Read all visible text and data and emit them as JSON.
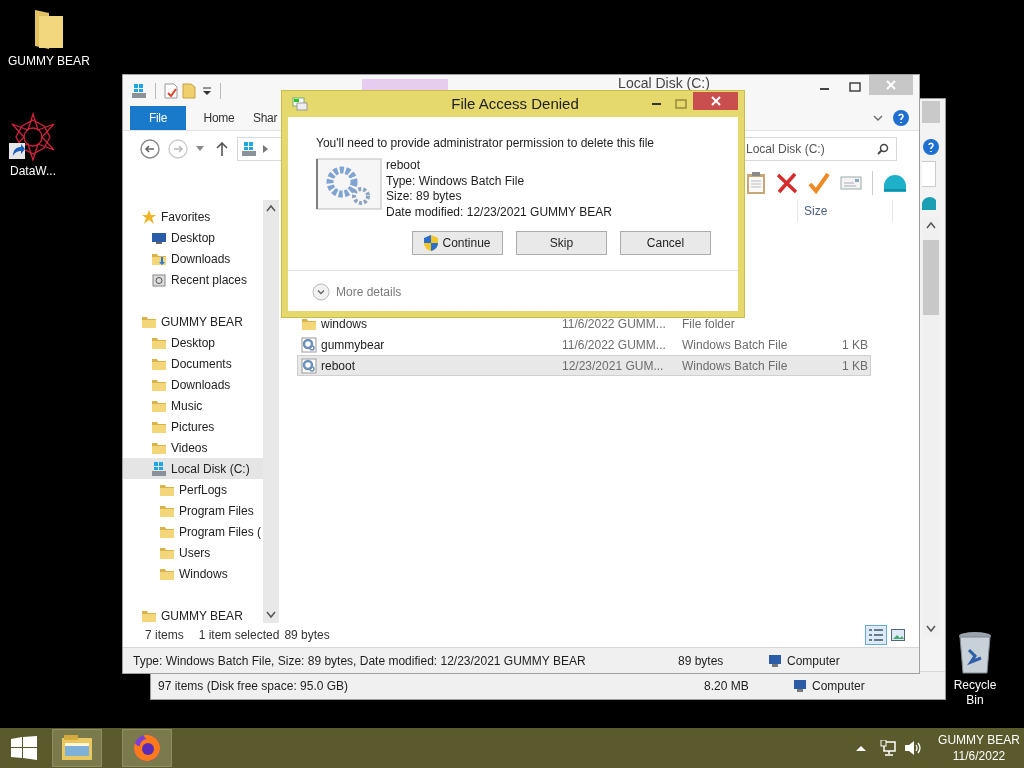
{
  "desktop_icons": [
    {
      "label": "GUMMY BEAR",
      "kind": "folder"
    },
    {
      "label": "DataW...",
      "kind": "shortcut"
    },
    {
      "label": "Recycle Bin",
      "kind": "recycle"
    }
  ],
  "back_window": {
    "status_items": "97 items (Disk free space: 95.0 GB)",
    "status_size": "8.20 MB",
    "status_location": "Computer"
  },
  "explorer": {
    "title": "Local Disk (C:)",
    "ribbon_tabs": [
      {
        "label": "File",
        "selected": true
      },
      {
        "label": "Home",
        "selected": false
      },
      {
        "label": "Shar",
        "selected": false
      }
    ],
    "search": {
      "placeholder": "Local Disk (C:)"
    },
    "columns": [
      "Size"
    ],
    "nav": [
      {
        "label": "Favorites",
        "kind": "star",
        "selected": false,
        "children": [
          {
            "label": "Desktop",
            "kind": "desktop",
            "selected": false
          },
          {
            "label": "Downloads",
            "kind": "download",
            "selected": false
          },
          {
            "label": "Recent places",
            "kind": "recent",
            "selected": false
          }
        ]
      },
      {
        "label": "GUMMY BEAR",
        "kind": "folder",
        "selected": false,
        "children": [
          {
            "label": "Desktop",
            "kind": "folder",
            "selected": false
          },
          {
            "label": "Documents",
            "kind": "folder",
            "selected": false
          },
          {
            "label": "Downloads",
            "kind": "folder",
            "selected": false
          },
          {
            "label": "Music",
            "kind": "folder",
            "selected": false
          },
          {
            "label": "Pictures",
            "kind": "folder",
            "selected": false
          },
          {
            "label": "Videos",
            "kind": "folder",
            "selected": false
          },
          {
            "label": "Local Disk (C:)",
            "kind": "drive",
            "selected": true,
            "children": [
              {
                "label": "PerfLogs",
                "kind": "folder",
                "selected": false
              },
              {
                "label": "Program Files",
                "kind": "folder",
                "selected": false
              },
              {
                "label": "Program Files (",
                "kind": "folder",
                "selected": false
              },
              {
                "label": "Users",
                "kind": "folder",
                "selected": false
              },
              {
                "label": "Windows",
                "kind": "folder",
                "selected": false
              }
            ]
          }
        ]
      },
      {
        "label": "GUMMY BEAR",
        "kind": "folder",
        "selected": false
      }
    ],
    "files": [
      {
        "name": "windows",
        "kind": "folder",
        "date": "11/6/2022 GUMM...",
        "type": "File folder",
        "selected": false
      },
      {
        "name": "gummybear",
        "kind": "batch",
        "date": "11/6/2022 GUMM...",
        "type": "Windows Batch File",
        "size": "1 KB",
        "selected": false
      },
      {
        "name": "reboot",
        "kind": "batch",
        "date": "12/23/2021 GUM...",
        "type": "Windows Batch File",
        "size": "1 KB",
        "selected": true
      }
    ],
    "status": {
      "count": "7 items",
      "selection": "1 item selected",
      "size": "89 bytes"
    },
    "details_bar": {
      "text": "Type: Windows Batch File, Size: 89 bytes, Date modified: 12/23/2021 GUMMY BEAR",
      "size": "89 bytes",
      "location": "Computer"
    }
  },
  "dialog": {
    "title": "File Access Denied",
    "message": "You'll need to provide administrator permission to delete this file",
    "file_name": "reboot",
    "file_type": "Type: Windows Batch File",
    "file_size": "Size: 89 bytes",
    "file_date": "Date modified: 12/23/2021 GUMMY BEAR",
    "buttons": [
      {
        "label": "Continue",
        "kind": "shield"
      },
      {
        "label": "Skip",
        "kind": "plain"
      },
      {
        "label": "Cancel",
        "kind": "plain"
      }
    ],
    "more_details": "More details"
  },
  "taskbar": {
    "apps": [
      {
        "kind": "explorer"
      },
      {
        "kind": "browser"
      }
    ],
    "clock_user": "GUMMY BEAR",
    "clock_date": "11/6/2022"
  }
}
